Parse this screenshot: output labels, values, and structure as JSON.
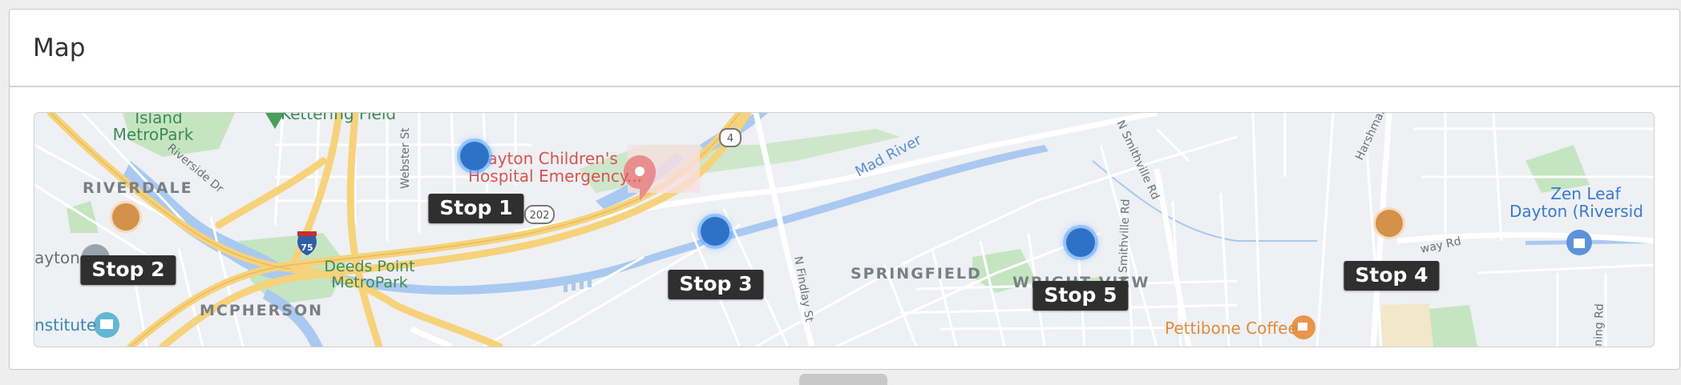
{
  "card": {
    "title": "Map"
  },
  "map": {
    "place_labels": {
      "island_metropark_1": "Island",
      "island_metropark_2": "MetroPark",
      "kettering_field": "Kettering Field",
      "riverdale": "RIVERDALE",
      "riverside_dr": "Riverside Dr",
      "dayton_left": "ayton",
      "institute": "nstitute",
      "mcpherson": "MCPHERSON",
      "deeds_point_1": "Deeds Point",
      "deeds_point_2": "MetroPark",
      "webster_st": "Webster St",
      "childrens_1": "Dayton Children's",
      "childrens_2": "Hospital Emergency...",
      "springfield": "SPRINGFIELD",
      "n_findlay_st": "N Findlay St",
      "mad_river": "Mad River",
      "wright_view": "WRIGHT VIEW",
      "n_smithville_1": "N Smithville Rd",
      "n_smithville_2": "N Smithville Rd",
      "harshman_ave": "Harshman Ave",
      "zen_leaf_1": "Zen Leaf",
      "zen_leaf_2": "Dayton (Riversid",
      "pettibone": "Pettibone Coffee",
      "way_rd": "way Rd",
      "shield_75": "75",
      "shield_202": "202",
      "shield_4": "4",
      "ning_rd": "ning Rd"
    },
    "stops": [
      {
        "label": "Stop 1",
        "color": "blue"
      },
      {
        "label": "Stop 2",
        "color": "orange"
      },
      {
        "label": "Stop 3",
        "color": "blue"
      },
      {
        "label": "Stop 4",
        "color": "orange"
      },
      {
        "label": "Stop 5",
        "color": "blue"
      }
    ],
    "colors": {
      "blue_marker": "#2e72c8",
      "orange_marker": "#d4914a",
      "water": "#a9c9f0",
      "park": "#c5e5c1",
      "highway": "#f6d27a",
      "stop_label_bg": "#2f2f2f"
    }
  }
}
